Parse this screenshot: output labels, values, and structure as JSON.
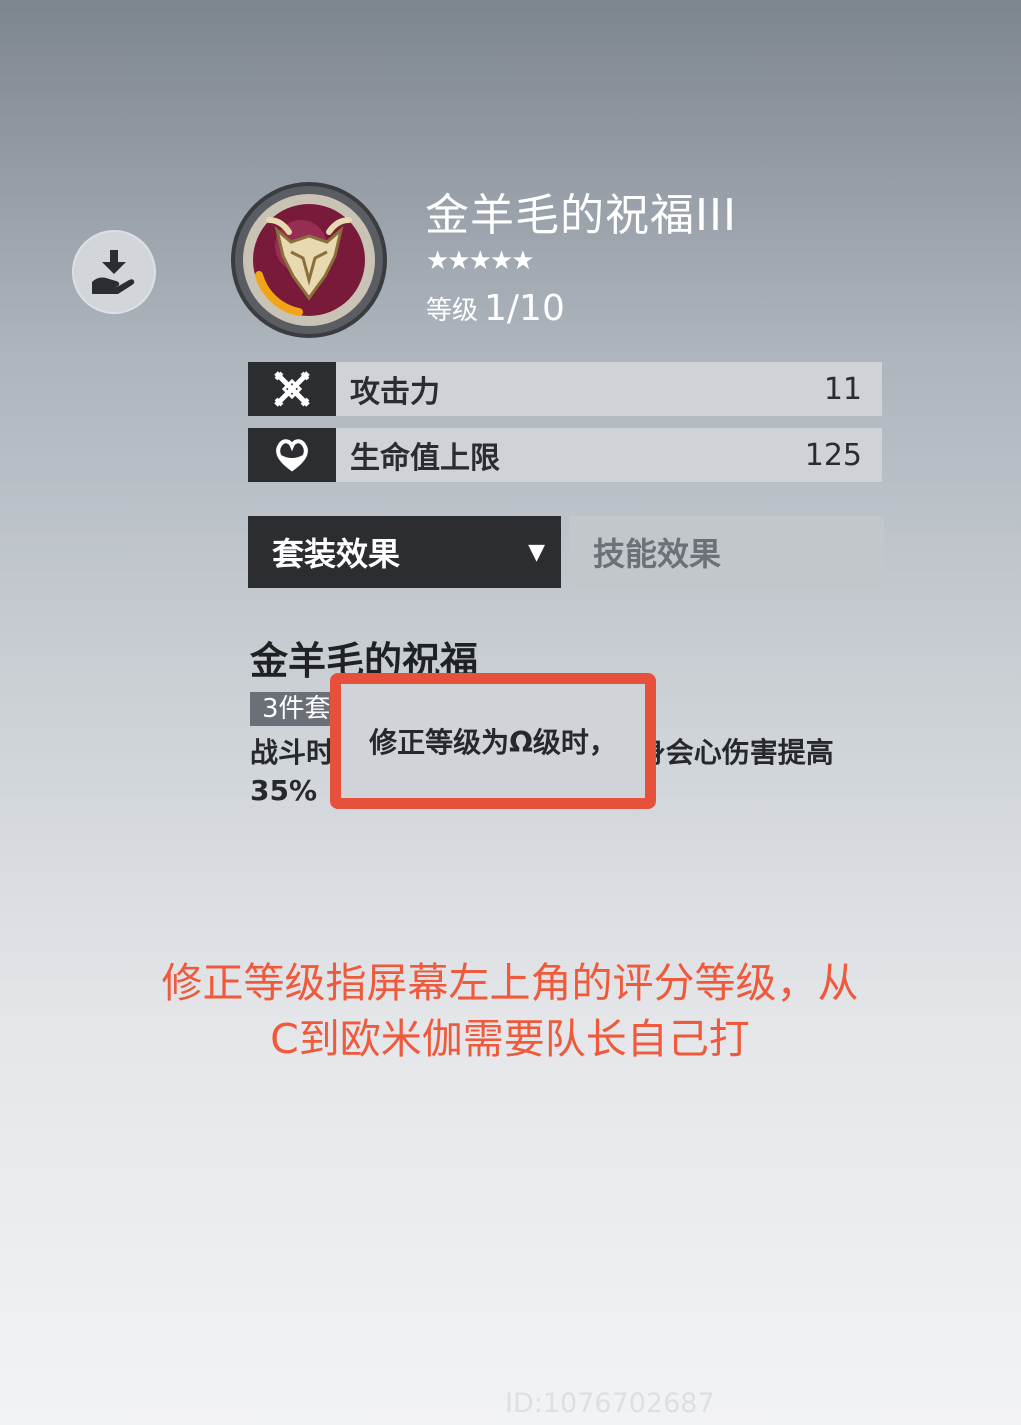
{
  "item": {
    "title": "金羊毛的祝福III",
    "stars": "★★★★★",
    "level_label": "等级",
    "level_value": "1/10"
  },
  "stats": [
    {
      "icon": "crossed-swords-icon",
      "label": "攻击力",
      "value": "11"
    },
    {
      "icon": "heart-icon",
      "label": "生命值上限",
      "value": "125"
    }
  ],
  "tabs": {
    "set_effect": "套装效果",
    "skill_effect": "技能效果",
    "dropdown_arrow": "▼"
  },
  "set": {
    "name": "金羊毛的祝福",
    "badge": "3件套",
    "description": "战斗时，修正等级为Ω级时，自身会心伤害提高35%"
  },
  "highlight": {
    "text": "修正等级为Ω级时，"
  },
  "annotation": {
    "text": "修正等级指屏幕左上角的评分等级，从C到欧米伽需要队长自己打"
  },
  "watermark": "ID:1076702687",
  "colors": {
    "highlight": "#e7503b",
    "annotation": "#ef5a3c",
    "dark_panel": "#2b2d31"
  }
}
